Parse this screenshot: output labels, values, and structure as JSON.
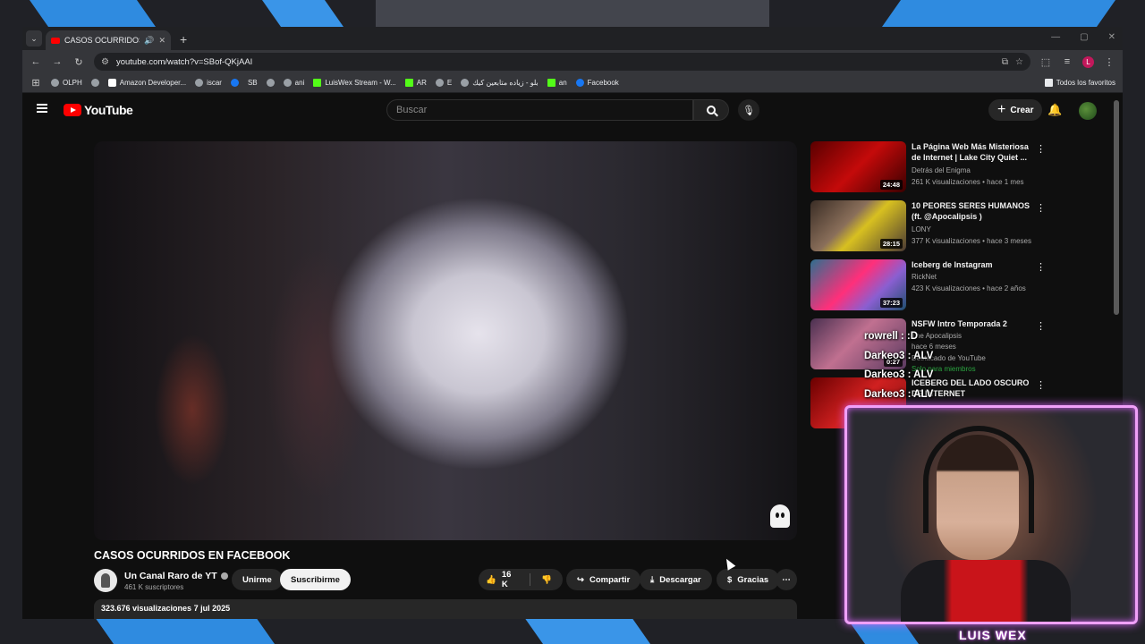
{
  "browser": {
    "tab_title": "CASOS OCURRIDOS EN FA",
    "url": "youtube.com/watch?v=SBof-QKjAAI",
    "bookmarks": [
      "OLPH",
      "Amazon Developer...",
      "iscar",
      "",
      "SB",
      "",
      "ani",
      "LuisWex Stream - W...",
      "AR",
      "E",
      "بلو - زياده متابعين كيك",
      "an",
      "Facebook"
    ],
    "all_bookmarks_label": "Todos los favoritos",
    "profile_initial": "L"
  },
  "youtube": {
    "logo_text": "YouTube",
    "search_placeholder": "Buscar",
    "create_label": "Crear"
  },
  "video": {
    "title": "CASOS OCURRIDOS EN FACEBOOK",
    "channel_name": "Un Canal Raro de YT",
    "subscribers": "461 K suscriptores",
    "join_label": "Unirme",
    "subscribe_label": "Suscribirme",
    "likes": "16 K",
    "share_label": "Compartir",
    "download_label": "Descargar",
    "thanks_label": "Gracias",
    "views_date": "323.676 visualizaciones  7 jul 2025"
  },
  "recommendations": [
    {
      "title": "La Página Web Más Misteriosa de Internet | Lake City Quiet ...",
      "channel": "Detrás del Enigma",
      "meta": "261 K visualizaciones • hace 1 mes",
      "duration": "24:48"
    },
    {
      "title": "10 PEORES SERES HUMANOS (ft. @Apocalipsis )",
      "channel": "LONY",
      "meta": "377 K visualizaciones • hace 3 meses",
      "duration": "28:15"
    },
    {
      "title": "Iceberg de Instagram",
      "channel": "RickNet",
      "meta": "423 K visualizaciones • hace 2 años",
      "duration": "37:23"
    },
    {
      "title": "NSFW Intro Temporada 2",
      "channel": "The Apocalipsis",
      "meta": "hace 6 meses",
      "duration": "0:27",
      "extra1": "Destacado de YouTube",
      "extra2": "Solo para miembros"
    },
    {
      "title": "ICEBERG DEL LADO OSCURO DE INTERNET",
      "channel": "",
      "meta": "",
      "duration": ""
    }
  ],
  "stream_overlay": {
    "chat": [
      "rowrell : :D",
      "Darkeo3 : ALV",
      "Darkeo3 : ALV",
      "Darkeo3 : ALV"
    ],
    "streamer_name": "LUIS WEX"
  }
}
